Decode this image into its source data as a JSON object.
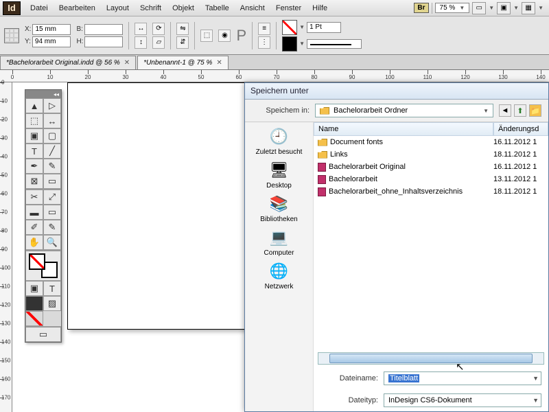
{
  "menubar": {
    "items": [
      "Datei",
      "Bearbeiten",
      "Layout",
      "Schrift",
      "Objekt",
      "Tabelle",
      "Ansicht",
      "Fenster",
      "Hilfe"
    ],
    "bridge": "Br",
    "zoom": "75 %"
  },
  "control": {
    "x_label": "X:",
    "x": "15 mm",
    "y_label": "Y:",
    "y": "94 mm",
    "w_label": "B:",
    "w": "",
    "h_label": "H:",
    "h": "",
    "weight": "1 Pt"
  },
  "tabs": [
    {
      "label": "*Bachelorarbeit Original.indd @ 56 %",
      "active": false
    },
    {
      "label": "*Unbenannt-1 @ 75 %",
      "active": true
    }
  ],
  "hruler_ticks": [
    0,
    10,
    20,
    30,
    40,
    50,
    60,
    70,
    80,
    90,
    100,
    110,
    120,
    130,
    140
  ],
  "vruler_ticks": [
    0,
    10,
    20,
    30,
    40,
    50,
    60,
    70,
    80,
    90,
    100,
    110,
    120,
    130,
    140,
    150,
    160,
    170
  ],
  "dialog": {
    "title": "Speichern unter",
    "savein_label": "Speichem in:",
    "savein_path": "Bachelorarbeit Ordner",
    "places": [
      "Zuletzt besucht",
      "Desktop",
      "Bibliotheken",
      "Computer",
      "Netzwerk"
    ],
    "cols": {
      "name": "Name",
      "date": "Änderungsd"
    },
    "rows": [
      {
        "type": "folder",
        "name": "Document fonts",
        "date": "16.11.2012 1"
      },
      {
        "type": "folder",
        "name": "Links",
        "date": "18.11.2012 1"
      },
      {
        "type": "indd",
        "name": "Bachelorarbeit Original",
        "date": "16.11.2012 1"
      },
      {
        "type": "indd",
        "name": "Bachelorarbeit",
        "date": "13.11.2012 1"
      },
      {
        "type": "indd",
        "name": "Bachelorarbeit_ohne_Inhaltsverzeichnis",
        "date": "18.11.2012 1"
      }
    ],
    "filename_label": "Dateiname:",
    "filename": "Titelblatt",
    "filetype_label": "Dateityp:",
    "filetype": "InDesign CS6-Dokument"
  }
}
